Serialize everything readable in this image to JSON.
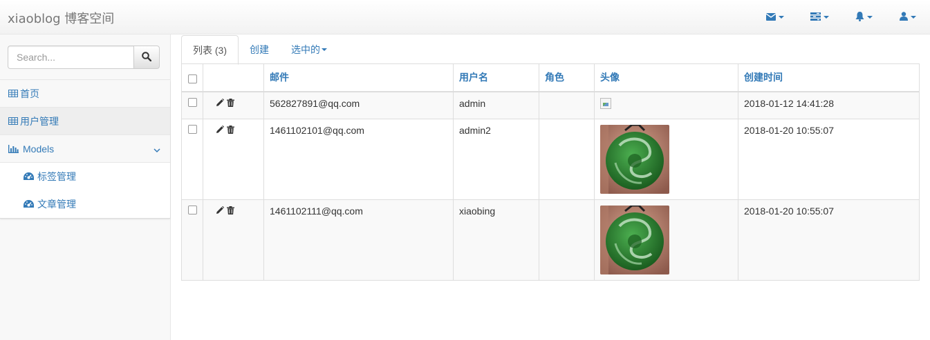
{
  "navbar": {
    "brand": "xiaoblog 博客空间",
    "items": [
      {
        "icon": "envelope-icon"
      },
      {
        "icon": "tasks-icon"
      },
      {
        "icon": "bell-icon"
      },
      {
        "icon": "user-icon"
      }
    ]
  },
  "sidebar": {
    "search_placeholder": "Search...",
    "items": [
      {
        "label": "首页",
        "icon": "table-icon"
      },
      {
        "label": "用户管理",
        "icon": "table-icon",
        "active": true
      },
      {
        "label": "Models",
        "icon": "bar-chart-icon",
        "expanded": true
      }
    ],
    "subitems": [
      {
        "label": "标签管理",
        "icon": "dashboard-icon"
      },
      {
        "label": "文章管理",
        "icon": "dashboard-icon"
      }
    ]
  },
  "tabs": [
    {
      "label": "列表 (3)",
      "active": true
    },
    {
      "label": "创建"
    },
    {
      "label": "选中的",
      "dropdown": true
    }
  ],
  "table": {
    "headers": [
      "邮件",
      "用户名",
      "角色",
      "头像",
      "创建时间"
    ],
    "rows": [
      {
        "email": "562827891@qq.com",
        "username": "admin",
        "role": "",
        "avatar": "broken-image",
        "created": "2018-01-12 14:41:28"
      },
      {
        "email": "1461102101@qq.com",
        "username": "admin2",
        "role": "",
        "avatar": "jade-pendant-photo",
        "created": "2018-01-20 10:55:07"
      },
      {
        "email": "1461102111@qq.com",
        "username": "xiaobing",
        "role": "",
        "avatar": "jade-pendant-photo",
        "created": "2018-01-20 10:55:07"
      }
    ]
  },
  "colors": {
    "link": "#337ab7",
    "border": "#dddddd",
    "jade": "#2e7d32"
  }
}
